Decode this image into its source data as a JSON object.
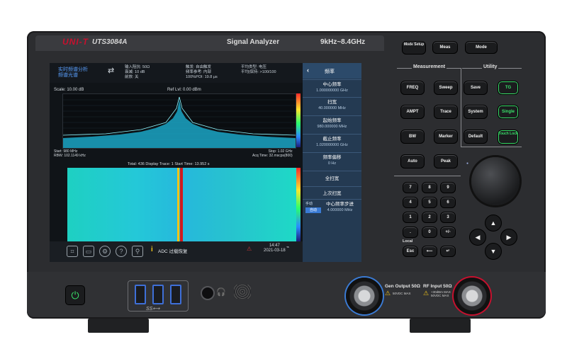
{
  "brand": {
    "name": "UNI-T",
    "model": "UTS3084A",
    "title": "Signal Analyzer",
    "range": "9kHz~8.4GHz"
  },
  "screen": {
    "mode": {
      "line1": "实时频谱分析",
      "line2": "频谱光谱"
    },
    "info_col1": [
      "输入阻抗: 50Ω",
      "衰减: 10 dB",
      "前放: 关"
    ],
    "info_col2": [
      "触发: 自由触发",
      "频率参考: 内部",
      "100%POI: 19.8 μs"
    ],
    "info_col3": [
      "平均类型: 电压",
      "平均|保持: >100/100"
    ],
    "scale": "Scale: 10.00 dB",
    "ref_level": "Ref Lvl: 0.00 dBm",
    "start": "Start: 980 MHz",
    "rbw": "RBW: 102.1149 kHz",
    "stop": "Stop: 1.02 GHz",
    "acq": "Acq Time: 32.mscps(800)",
    "waterfall_header": "Total: 436  Display Trace: 1  Start Time: 13.952 s",
    "message": "ADC 过载恢复",
    "clock_time": "14:47",
    "clock_date": "2021-03-18"
  },
  "menu": {
    "title": "频率",
    "items": [
      {
        "label": "中心频率",
        "value": "1.000000000 GHz"
      },
      {
        "label": "扫宽",
        "value": "40.000000 MHz"
      },
      {
        "label": "起始频率",
        "value": "980.000000 MHz"
      },
      {
        "label": "截止频率",
        "value": "1.020000000 GHz"
      },
      {
        "label": "频率偏移",
        "value": "0 Hz"
      },
      {
        "label": "全扫宽",
        "value": ""
      },
      {
        "label": "上次扫宽",
        "value": ""
      }
    ],
    "step_small": "手动",
    "step_btn": "自动",
    "step_label": "中心频率步进",
    "step_value": "4.000000 MHz"
  },
  "panel": {
    "top_buttons": [
      "Mode Setup",
      "Meas",
      "Mode"
    ],
    "measurement_label": "Measurement",
    "utility_label": "Utility",
    "meas_buttons": [
      "FREQ",
      "Sweep",
      "AMPT",
      "Trace",
      "BW",
      "Marker",
      "Auto",
      "Peak"
    ],
    "util_buttons": [
      "Save",
      "System",
      "Default"
    ],
    "green_buttons": [
      "TG",
      "Single",
      "Touch Lock"
    ],
    "keypad": [
      "7",
      "8",
      "9",
      "4",
      "5",
      "6",
      "1",
      "2",
      "3",
      ".",
      "0",
      "+/-"
    ],
    "local_label": "Local",
    "esc_label": "Esc",
    "back_label": "⟵",
    "enter_label": "↵"
  },
  "front": {
    "usb_label": "SS⟷",
    "gen_output": "Gen Output 50Ω",
    "gen_warn": "50VDC MAX",
    "rf_input": "RF Input 50Ω",
    "rf_warn1": "+30dBm MAX",
    "rf_warn2": "50VDC MAX"
  }
}
